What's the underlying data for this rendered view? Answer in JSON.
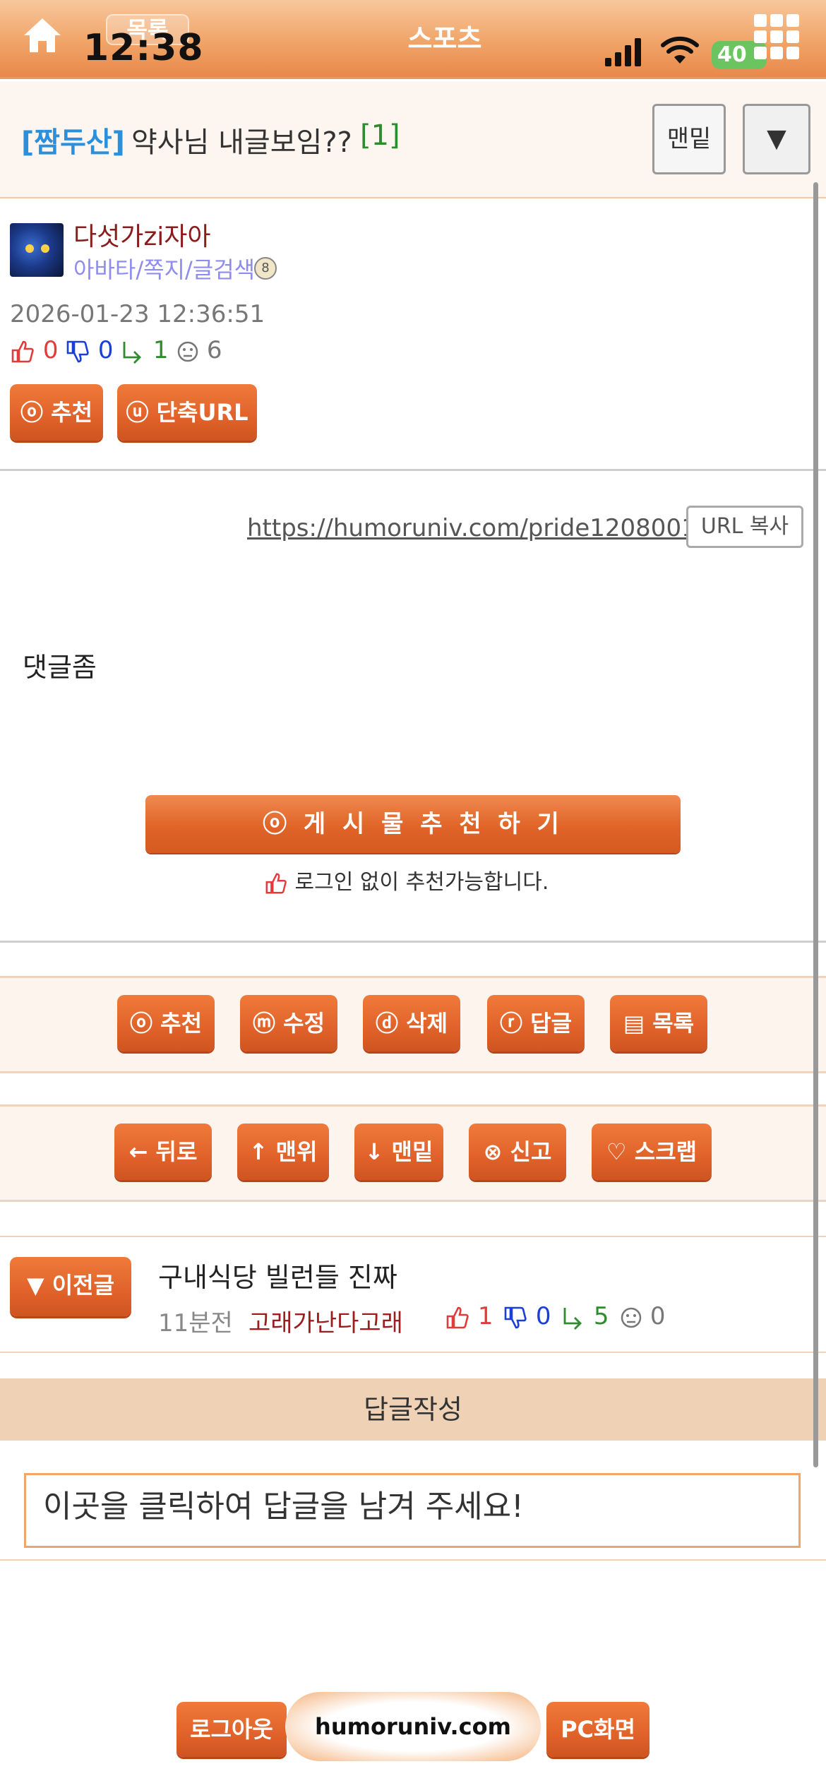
{
  "topbar": {
    "back_label": "목록",
    "time": "12:38",
    "category": "스포츠",
    "battery": "40"
  },
  "post": {
    "category": "[짬두산]",
    "title": "약사님 내글보임??",
    "comment_count": "[1]",
    "nav_bottom": "맨밑",
    "nav_toggle": "▼"
  },
  "author": {
    "name": "다섯가zi자아",
    "links": "아바타/쪽지/글검색",
    "date": "2026-01-23 12:36:51",
    "likes": "0",
    "dislikes": "0",
    "replies": "1",
    "views": "6"
  },
  "action_buttons": {
    "recommend": "ⓞ 추천",
    "short_url": "ⓤ 단축URL"
  },
  "url": {
    "link": "https://humoruniv.com/pride1208001",
    "copy_label": "URL 복사"
  },
  "content": {
    "text": "댓글좀"
  },
  "recommend": {
    "button": "ⓞ 게 시 물   추 천 하 기",
    "note": "로그인 없이 추천가능합니다."
  },
  "toolbar1": [
    {
      "label": "ⓞ 추천",
      "name": "recommend-button"
    },
    {
      "label": "ⓜ 수정",
      "name": "edit-button"
    },
    {
      "label": "ⓓ 삭제",
      "name": "delete-button"
    },
    {
      "label": "ⓡ 답글",
      "name": "reply-button"
    },
    {
      "label": "▤ 목록",
      "name": "list-button"
    }
  ],
  "toolbar2": [
    {
      "label": "← 뒤로",
      "name": "back-button"
    },
    {
      "label": "↑ 맨위",
      "name": "top-button"
    },
    {
      "label": "↓ 맨밑",
      "name": "bottom-button"
    },
    {
      "label": "⊗ 신고",
      "name": "report-button"
    },
    {
      "label": "♡ 스크랩",
      "name": "scrap-button"
    }
  ],
  "prev_post": {
    "button": "▼ 이전글",
    "title": "구내식당 빌런들 진짜",
    "time": "11분전",
    "author": "고래가난다고래",
    "likes": "1",
    "dislikes": "0",
    "replies": "5",
    "views": "0"
  },
  "reply": {
    "header": "답글작성",
    "placeholder": "이곳을 클릭하여 답글을 남겨 주세요!"
  },
  "bottom": {
    "logout": "로그아웃",
    "site": "humoruniv.com",
    "pc_view": "PC화면"
  },
  "colors": {
    "accent": "#e0622a",
    "like": "#e23b3b",
    "dislike": "#1a3fd8",
    "reply": "#2e8b2e"
  }
}
